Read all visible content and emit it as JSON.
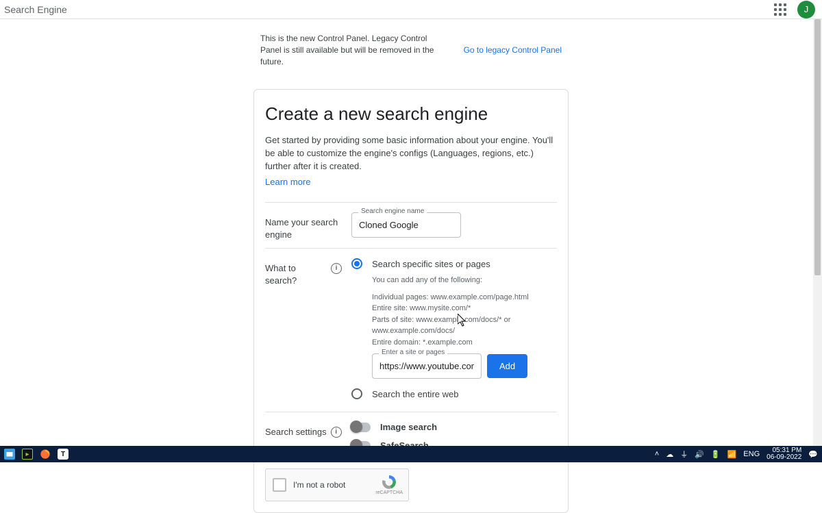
{
  "topbar": {
    "title": "Search Engine",
    "avatar_initial": "J"
  },
  "legacy": {
    "text": "This is the new Control Panel. Legacy Control Panel is still available but will be removed in the future.",
    "link": "Go to legacy Control Panel"
  },
  "card": {
    "heading": "Create a new search engine",
    "description": "Get started by providing some basic information about your engine. You'll be able to customize the engine's configs (Languages, regions, etc.) further after it is created.",
    "learn_more": "Learn more"
  },
  "form": {
    "name_section_label": "Name your search engine",
    "name_float_label": "Search engine name",
    "name_value": "Cloned Google",
    "what_label": "What to search?",
    "option_specific": "Search specific sites or pages",
    "option_entire": "Search the entire web",
    "helper_lead": "You can add any of the following:",
    "helper_lines": [
      "Individual pages: www.example.com/page.html",
      "Entire site: www.mysite.com/*",
      "Parts of site: www.example.com/docs/* or www.example.com/docs/",
      "Entire domain: *.example.com"
    ],
    "site_float_label": "Enter a site or pages",
    "site_value": "https://www.youtube.com/",
    "add_label": "Add",
    "settings_label": "Search settings",
    "toggle_image": "Image search",
    "toggle_safe": "SafeSearch"
  },
  "recaptcha": {
    "text": "I'm not a robot",
    "brand": "reCAPTCHA"
  },
  "taskbar": {
    "lang": "ENG",
    "time": "05:31 PM",
    "date": "06-09-2022"
  }
}
